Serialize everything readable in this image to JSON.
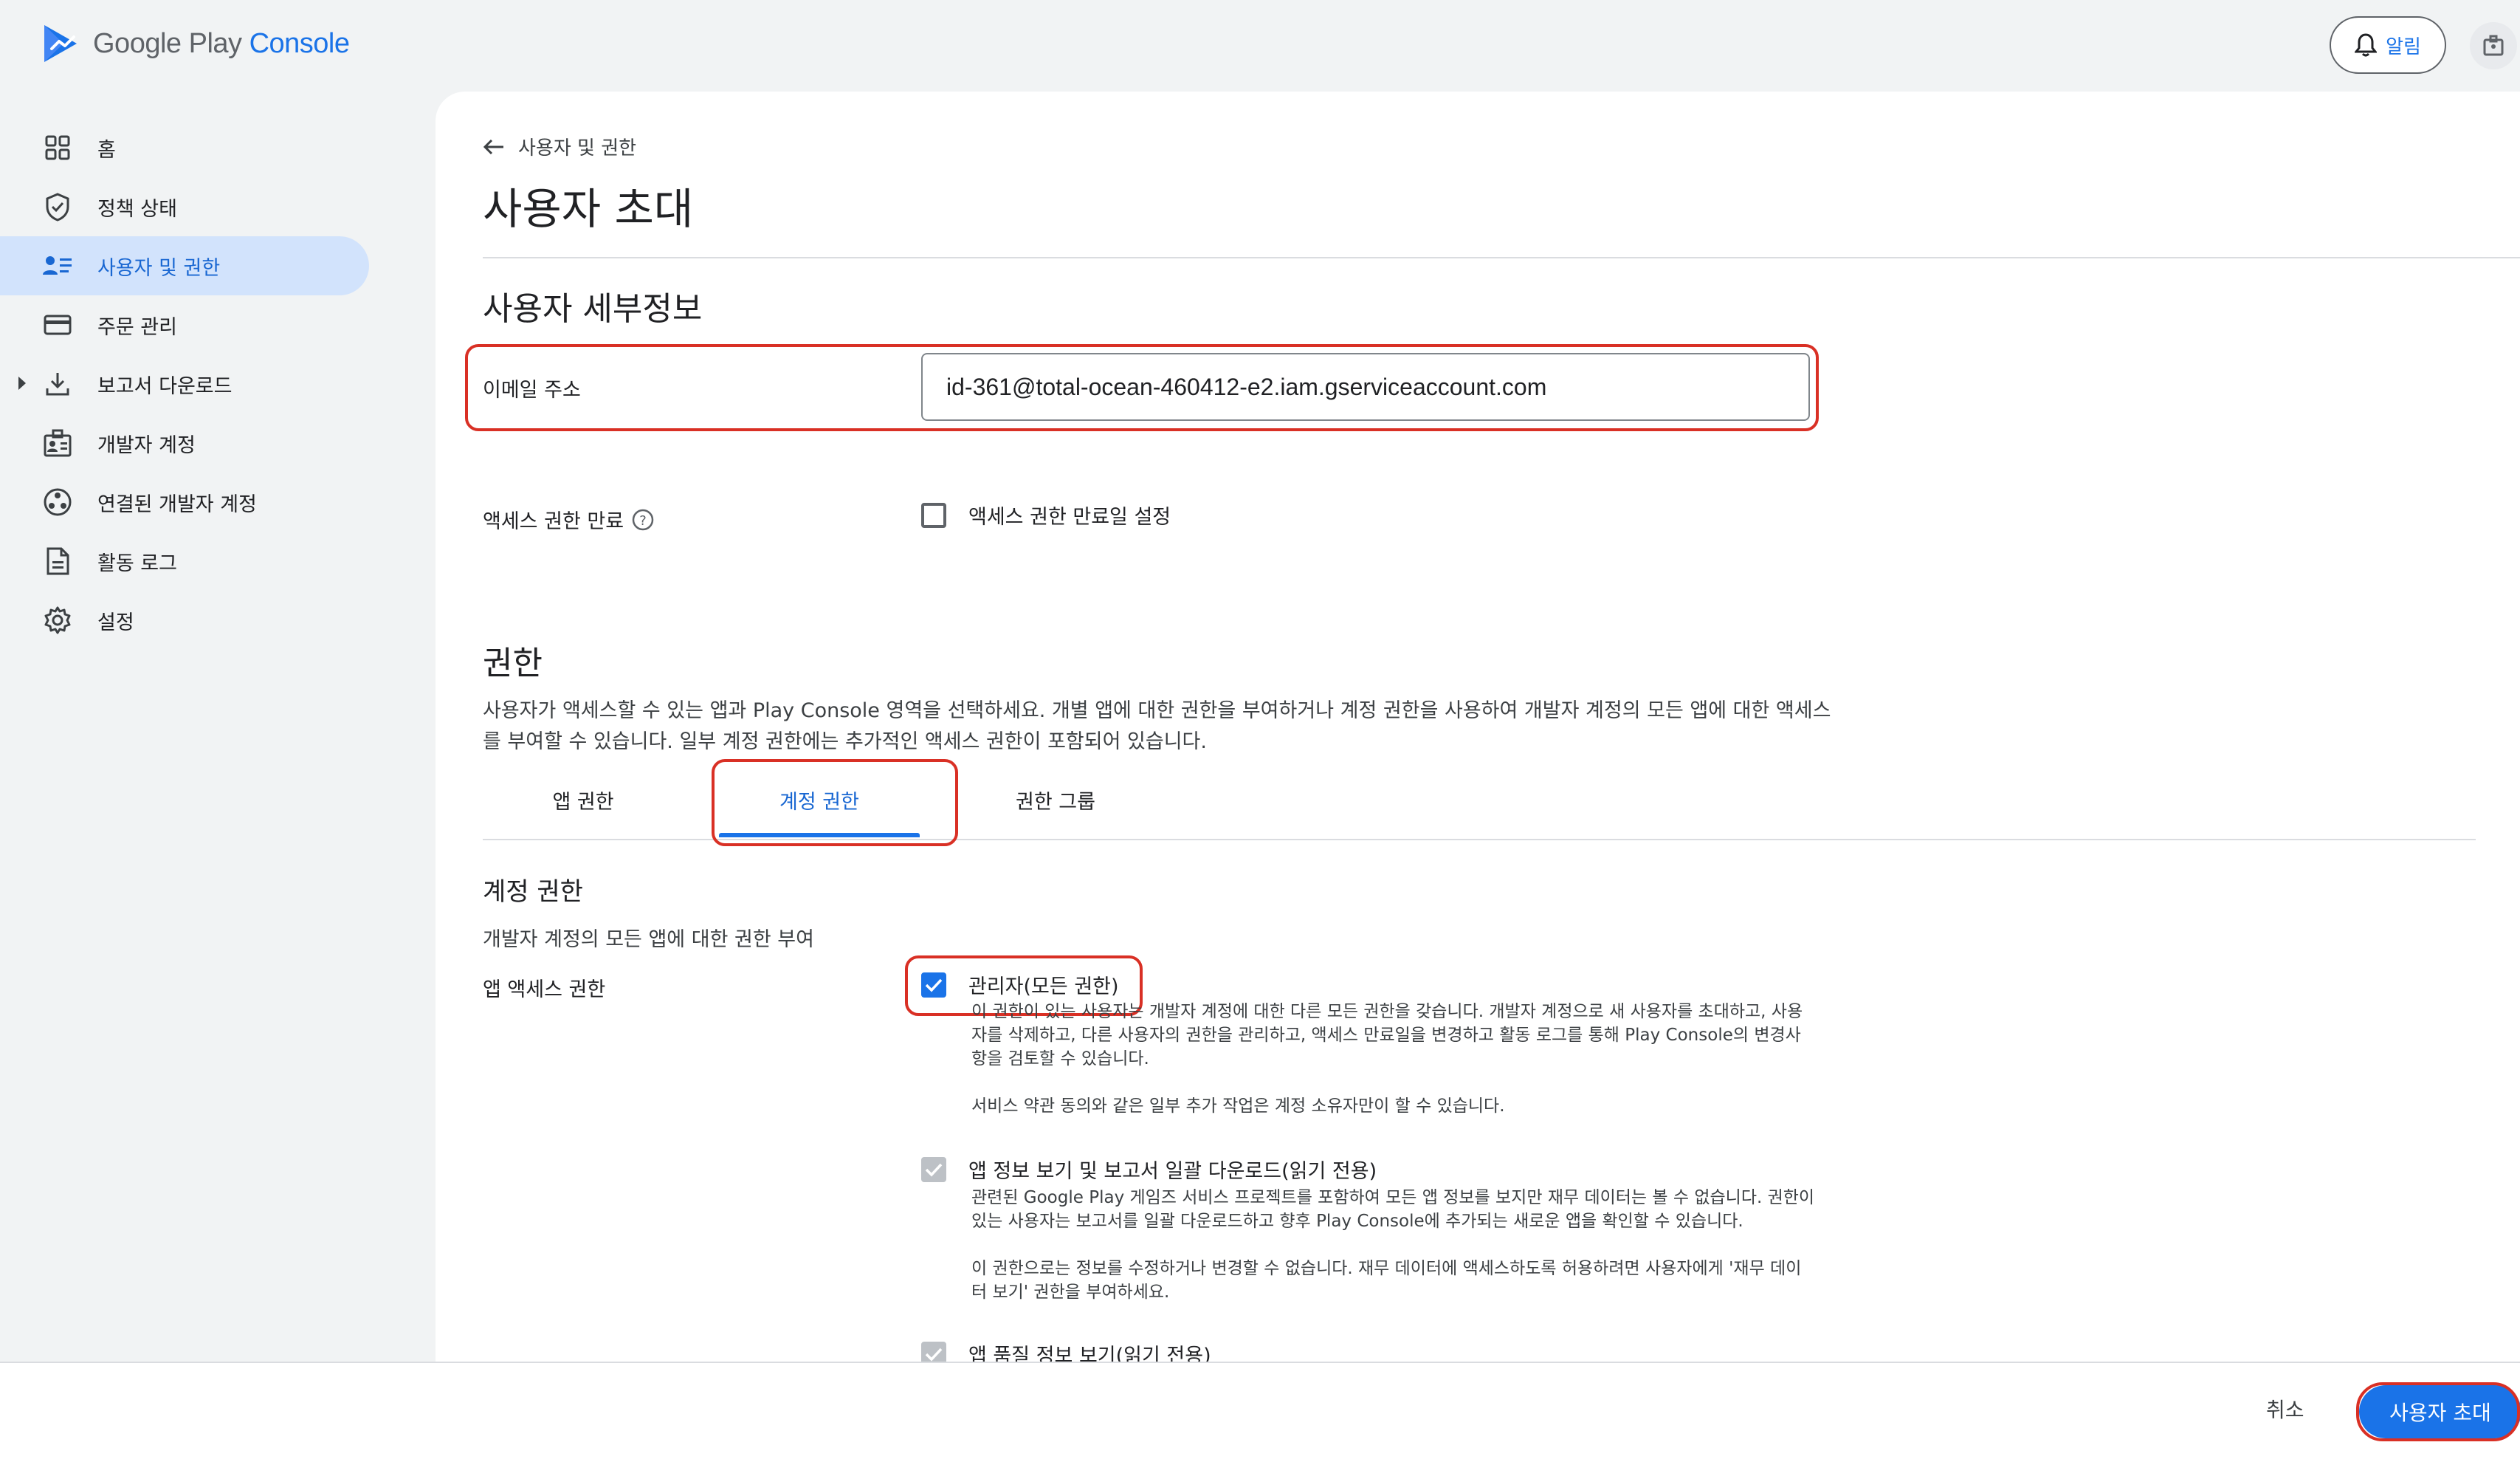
{
  "app": {
    "logo_google_play": "Google Play",
    "logo_console": "Console",
    "alert_label": "알림"
  },
  "sidebar": {
    "items": [
      {
        "label": "홈",
        "icon": "dashboard-grid-icon"
      },
      {
        "label": "정책 상태",
        "icon": "shield-check-icon"
      },
      {
        "label": "사용자 및 권한",
        "icon": "people-list-icon",
        "active": true
      },
      {
        "label": "주문 관리",
        "icon": "credit-card-icon"
      },
      {
        "label": "보고서 다운로드",
        "icon": "download-icon",
        "expandable": true
      },
      {
        "label": "개발자 계정",
        "icon": "developer-badge-icon"
      },
      {
        "label": "연결된 개발자 계정",
        "icon": "linked-accounts-icon"
      },
      {
        "label": "활동 로그",
        "icon": "document-icon"
      },
      {
        "label": "설정",
        "icon": "gear-icon"
      }
    ]
  },
  "main": {
    "breadcrumb": "사용자 및 권한",
    "title": "사용자 초대",
    "user_details": {
      "heading": "사용자 세부정보",
      "email_label": "이메일 주소",
      "email_value": "id-361@total-ocean-460412-e2.iam.gserviceaccount.com",
      "expiry_label": "액세스 권한 만료",
      "expiry_checkbox_label": "액세스 권한 만료일 설정"
    },
    "permissions": {
      "heading": "권한",
      "description_line1": "사용자가 액세스할 수 있는 앱과 Play Console 영역을 선택하세요. 개별 앱에 대한 권한을 부여하거나 계정 권한을 사용하여 개발자 계정의 모든 앱에 대한 액세스",
      "description_line2": "를 부여할 수 있습니다. 일부 계정 권한에는 추가적인 액세스 권한이 포함되어 있습니다.",
      "tabs": [
        "앱 권한",
        "계정 권한",
        "권한 그룹"
      ],
      "active_tab": "계정 권한"
    },
    "account_permissions": {
      "heading": "계정 권한",
      "subheading": "개발자 계정의 모든 앱에 대한 권한 부여",
      "app_access_label": "앱 액세스 권한",
      "admin": {
        "label": "관리자(모든 권한)",
        "checked": true,
        "desc1": "이 권한이 있는 사용자는 개발자 계정에 대한 다른 모든 권한을 갖습니다. 개발자 계정으로 새 사용자를 초대하고, 사용",
        "desc2": "자를 삭제하고, 다른 사용자의 권한을 관리하고, 액세스 만료일을 변경하고 활동 로그를 통해 Play Console의 변경사",
        "desc3": "항을 검토할 수 있습니다.",
        "desc4": "서비스 약관 동의와 같은 일부 추가 작업은 계정 소유자만이 할 수 있습니다."
      },
      "view_app_info": {
        "label": "앱 정보 보기 및 보고서 일괄 다운로드(읽기 전용)",
        "checked": true,
        "disabled": true,
        "desc1": "관련된 Google Play 게임즈 서비스 프로젝트를 포함하여 모든 앱 정보를 보지만 재무 데이터는 볼 수 없습니다. 권한이",
        "desc2": "있는 사용자는 보고서를 일괄 다운로드하고 향후 Play Console에 추가되는 새로운 앱을 확인할 수 있습니다.",
        "desc3": "이 권한으로는 정보를 수정하거나 변경할 수 없습니다. 재무 데이터에 액세스하도록 허용하려면 사용자에게 '재무 데이",
        "desc4": "터 보기' 권한을 부여하세요."
      },
      "view_quality": {
        "label": "앱 품질 정보 보기(읽기 전용)",
        "checked": true,
        "disabled": true
      }
    }
  },
  "footer": {
    "cancel_label": "취소",
    "invite_label": "사용자 초대"
  },
  "colors": {
    "accent": "#1a73e8",
    "highlight": "#d93025",
    "active_nav_bg": "#d2e3fc"
  }
}
